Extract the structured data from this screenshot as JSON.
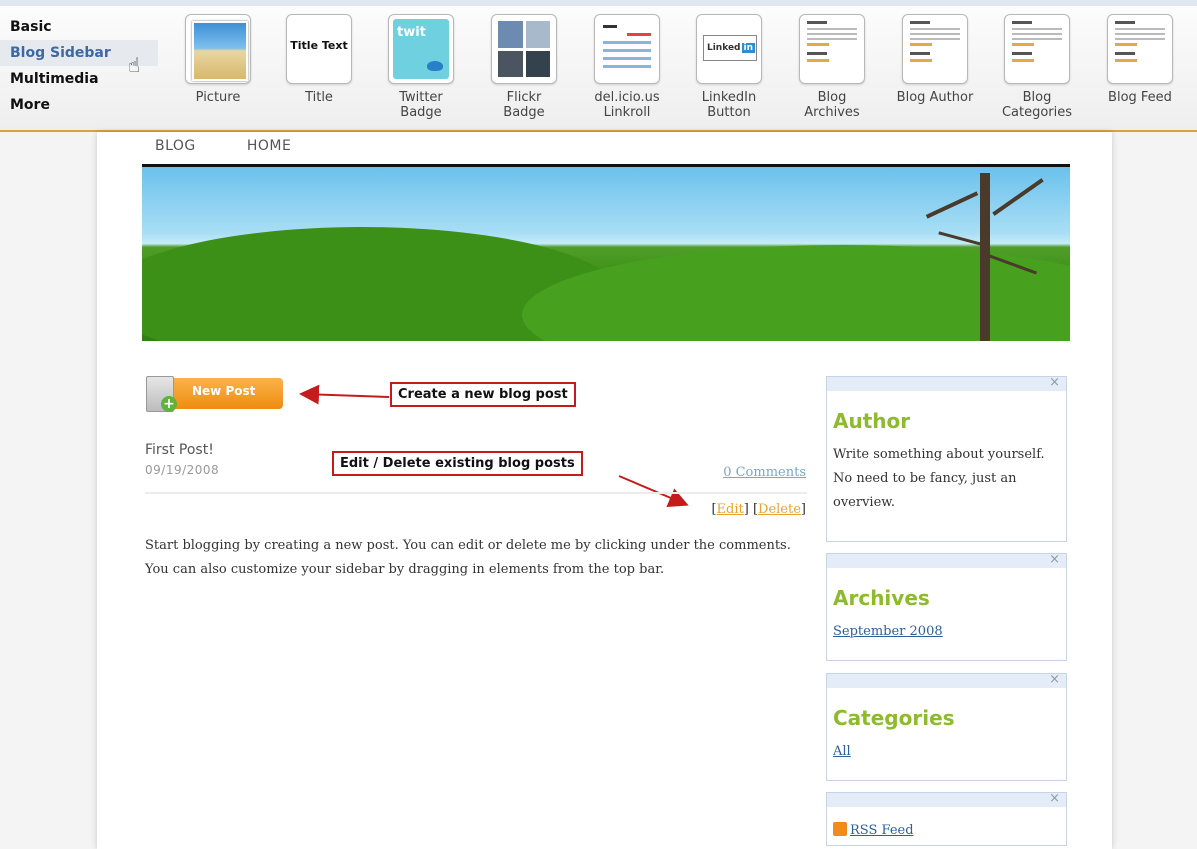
{
  "categories": [
    "Basic",
    "Blog Sidebar",
    "Multimedia",
    "More"
  ],
  "palette": {
    "picture": "Picture",
    "title": "Title",
    "title_thumb": "Title Text",
    "twitter_l1": "Twitter",
    "twitter_l2": "Badge",
    "twitter_thumb": "twit",
    "flickr_l1": "Flickr",
    "flickr_l2": "Badge",
    "delicious_l1": "del.icio.us",
    "delicious_l2": "Linkroll",
    "linkedin_l1": "LinkedIn",
    "linkedin_l2": "Button",
    "linkedin_thumb_a": "Linked",
    "linkedin_thumb_b": "in",
    "archives_l1": "Blog",
    "archives_l2": "Archives",
    "author": "Blog Author",
    "categories_l1": "Blog",
    "categories_l2": "Categories",
    "feed": "Blog Feed"
  },
  "nav": [
    "BLOG",
    "HOME"
  ],
  "new_post": "New Post",
  "callouts": {
    "create": "Create a new blog post",
    "edit": "Edit / Delete existing blog posts"
  },
  "post": {
    "title": "First Post!",
    "date": "09/19/2008",
    "comments": "0 Comments",
    "edit": "Edit",
    "delete": "Delete",
    "body": "Start blogging by creating a new post. You can edit or delete me by clicking under the comments. You can also customize your sidebar by dragging in elements from the top bar."
  },
  "sidebar": {
    "author_title": "Author",
    "author_text": "Write something about yourself. No need to be fancy, just an overview.",
    "archives_title": "Archives",
    "archives_link": "September 2008",
    "categories_title": "Categories",
    "categories_link": "All",
    "rss_link": "RSS Feed",
    "close": "×"
  },
  "colors": {
    "accent_orange": "#ef8c11",
    "sidebar_title_green": "#8dbb2d",
    "callout_red": "#c61b1b",
    "active_category_blue": "#3a6aa6"
  }
}
